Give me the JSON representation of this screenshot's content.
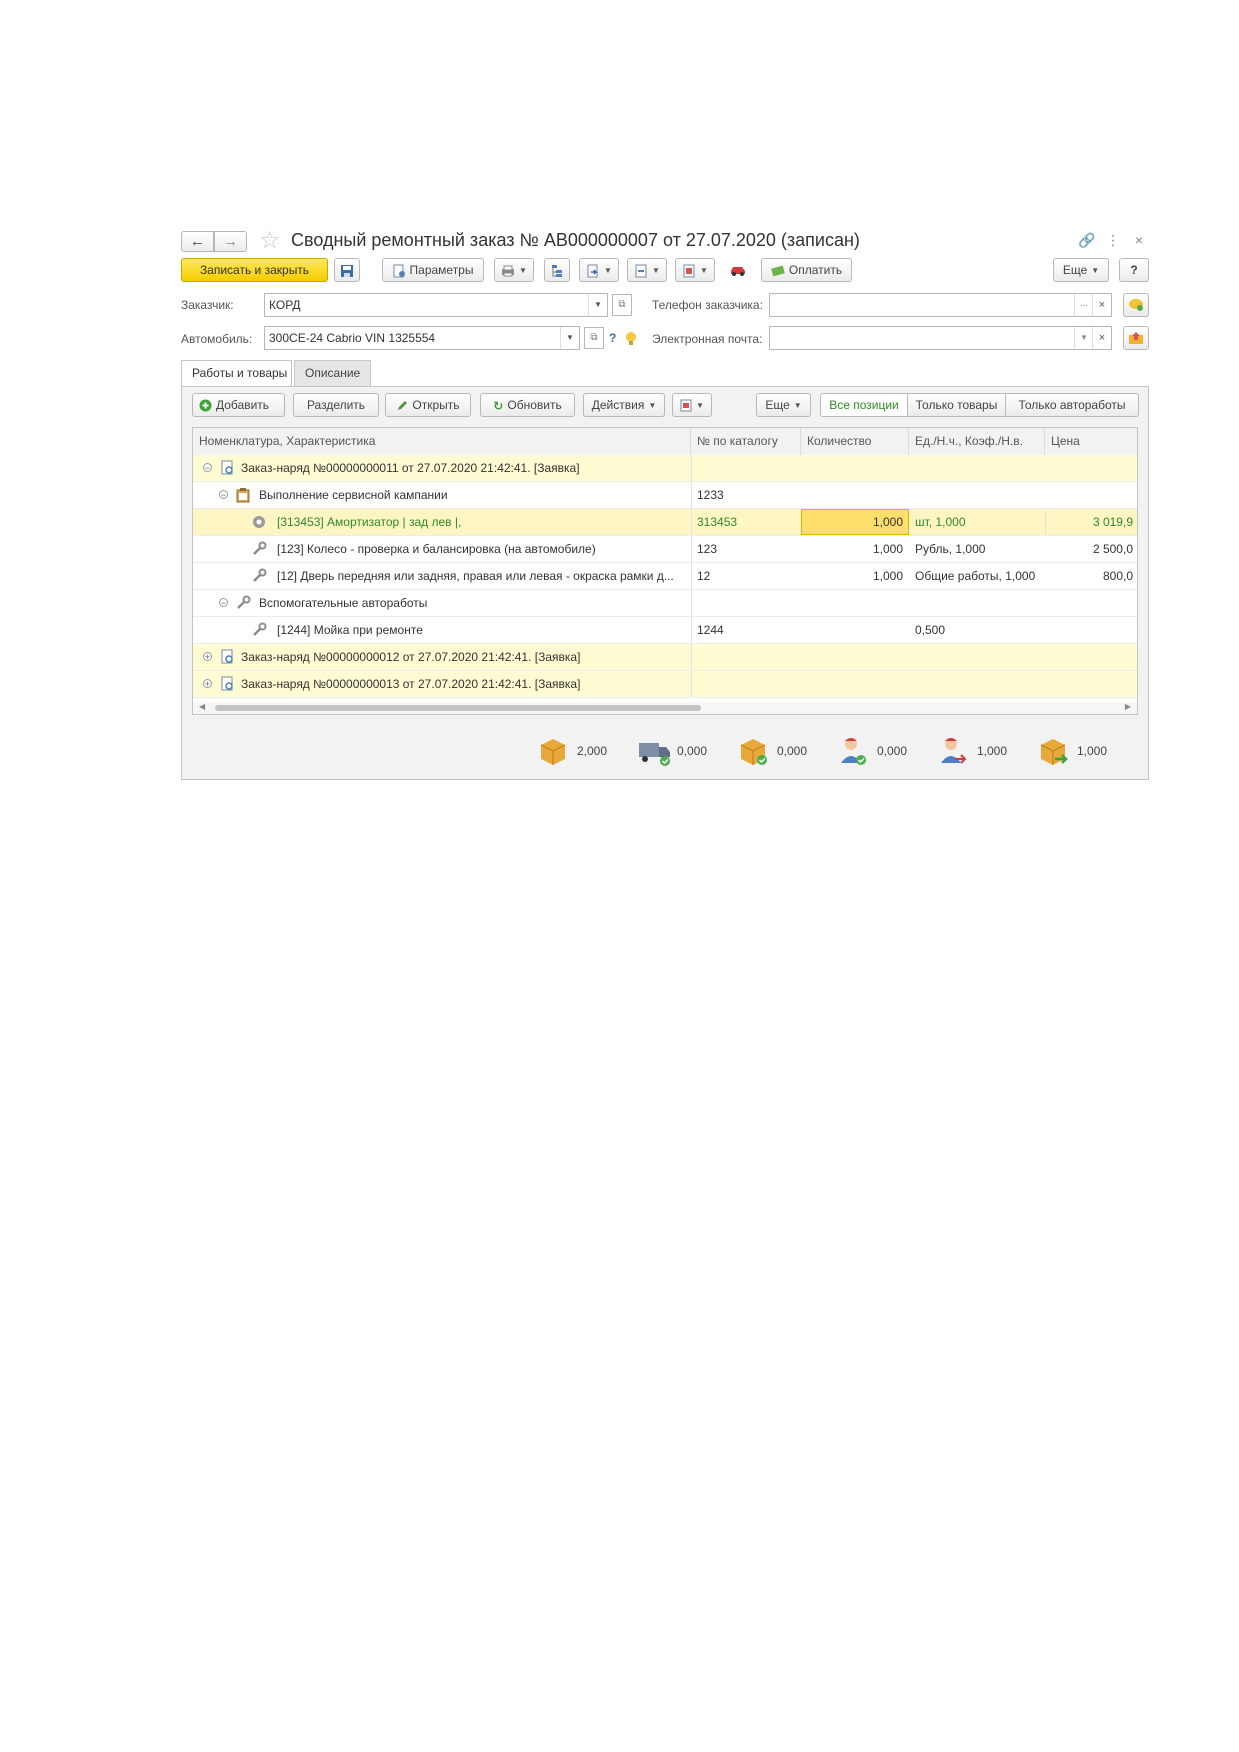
{
  "window": {
    "title": "Сводный ремонтный заказ № АВ000000007 от 27.07.2020 (записан)"
  },
  "toolbar": {
    "save_close": "Записать и закрыть",
    "params": "Параметры",
    "pay": "Оплатить",
    "more": "Еще",
    "help": "?"
  },
  "form": {
    "customer_label": "Заказчик:",
    "customer_value": "КОРД",
    "phone_label": "Телефон заказчика:",
    "phone_value": "",
    "car_label": "Автомобиль:",
    "car_value": "300CE-24 Cabrio VIN 1325554",
    "car_help": "?",
    "email_label": "Электронная почта:",
    "email_value": ""
  },
  "tabs": [
    {
      "label": "Работы и товары",
      "active": true
    },
    {
      "label": "Описание",
      "active": false
    }
  ],
  "table_toolbar": {
    "add": "Добавить",
    "split": "Разделить",
    "open": "Открыть",
    "refresh": "Обновить",
    "actions": "Действия",
    "more": "Еще",
    "filter_all": "Все позиции",
    "filter_goods": "Только товары",
    "filter_works": "Только автоработы"
  },
  "table": {
    "columns": [
      "Номенклатура, Характеристика",
      "№ по каталогу",
      "Количество",
      "Ед./Н.ч., Коэф./Н.в.",
      "Цена"
    ],
    "rows": [
      {
        "name": "Заказ-наряд №00000000011 от 27.07.2020 21:42:41. [Заявка]",
        "catalog": "",
        "qty": "",
        "unit": "",
        "price": ""
      },
      {
        "name": "Выполнение сервисной кампании",
        "catalog": "1233",
        "qty": "",
        "unit": "",
        "price": ""
      },
      {
        "name": "[313453] Амортизатор | зад лев |,",
        "catalog": "313453",
        "qty": "1,000",
        "unit": "шт, 1,000",
        "price": "3 019,9"
      },
      {
        "name": "[123] Колесо - проверка и балансировка (на автомобиле)",
        "catalog": "123",
        "qty": "1,000",
        "unit": "Рубль, 1,000",
        "price": "2 500,0"
      },
      {
        "name": "[12] Дверь передняя или задняя, правая или левая - окраска рамки д...",
        "catalog": "12",
        "qty": "1,000",
        "unit": "Общие работы, 1,000",
        "price": "800,0"
      },
      {
        "name": "Вспомогательные автоработы",
        "catalog": "",
        "qty": "",
        "unit": "",
        "price": ""
      },
      {
        "name": "[1244] Мойка при ремонте",
        "catalog": "1244",
        "qty": "",
        "unit": "0,500",
        "price": ""
      },
      {
        "name": "Заказ-наряд №00000000012 от 27.07.2020 21:42:41. [Заявка]",
        "catalog": "",
        "qty": "",
        "unit": "",
        "price": ""
      },
      {
        "name": "Заказ-наряд №00000000013 от 27.07.2020 21:42:41. [Заявка]",
        "catalog": "",
        "qty": "",
        "unit": "",
        "price": ""
      }
    ]
  },
  "totals": [
    {
      "icon": "box-icon",
      "value": "2,000"
    },
    {
      "icon": "truck-check-icon",
      "value": "0,000"
    },
    {
      "icon": "box-check-icon",
      "value": "0,000"
    },
    {
      "icon": "worker-check-icon",
      "value": "0,000"
    },
    {
      "icon": "worker-arrow-icon",
      "value": "1,000"
    },
    {
      "icon": "box-arrow-icon",
      "value": "1,000"
    }
  ],
  "colors": {
    "primary_button": "#f4cd00",
    "order_row_bg": "#fffbd2",
    "selected_cell": "#ffdf6b",
    "green_text": "#2f8a24"
  }
}
